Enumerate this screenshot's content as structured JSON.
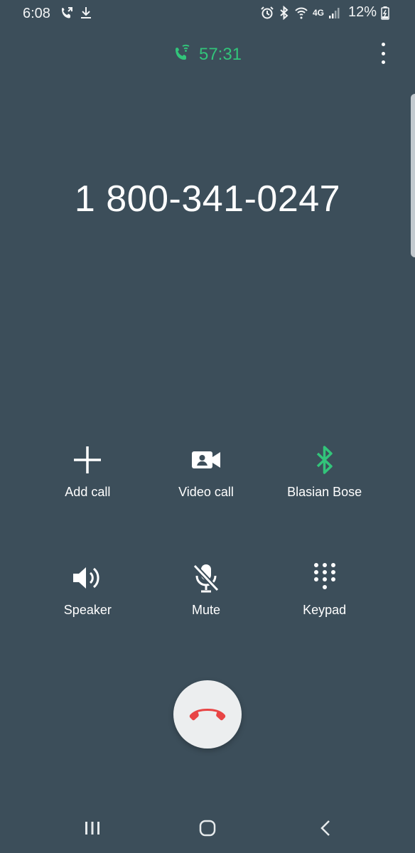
{
  "status_bar": {
    "time": "6:08",
    "battery_percent": "12%",
    "left_icons": [
      "call-forward-icon",
      "download-icon"
    ],
    "right_icons": [
      "alarm-icon",
      "bluetooth-icon",
      "wifi-calling-icon",
      "lte-icon",
      "signal-icon",
      "battery-charging-icon"
    ],
    "network_label": "4G"
  },
  "call": {
    "duration": "57:31",
    "number": "1 800-341-0247",
    "status_icon": "wifi-call-icon"
  },
  "controls": {
    "add_call": {
      "label": "Add call",
      "icon": "plus-icon"
    },
    "video_call": {
      "label": "Video call",
      "icon": "video-camera-icon"
    },
    "bluetooth": {
      "label": "Blasian Bose",
      "icon": "bluetooth-icon"
    },
    "speaker": {
      "label": "Speaker",
      "icon": "speaker-icon"
    },
    "mute": {
      "label": "Mute",
      "icon": "microphone-off-icon"
    },
    "keypad": {
      "label": "Keypad",
      "icon": "keypad-icon"
    }
  },
  "end_call": {
    "icon": "phone-hangup-icon"
  },
  "navigation": {
    "recent_icon": "recent-apps-icon",
    "home_icon": "home-icon",
    "back_icon": "back-icon"
  },
  "colors": {
    "background": "#3c4e5a",
    "accent_green": "#32c47a",
    "end_call_red": "#e84545",
    "end_call_button": "#eceeef"
  }
}
